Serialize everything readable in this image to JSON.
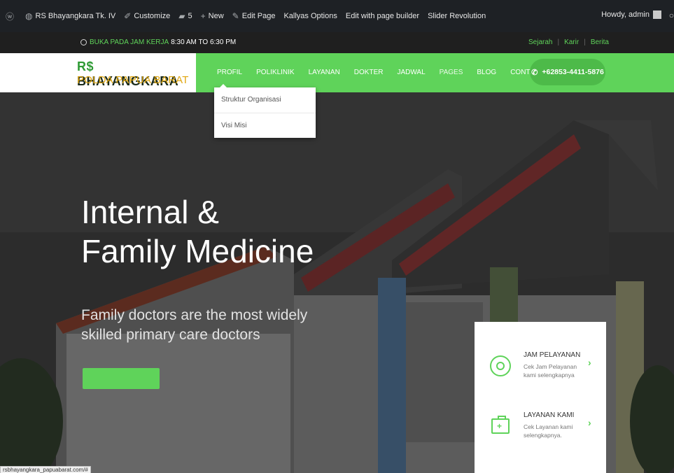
{
  "admin_bar": {
    "site_name": "RS Bhayangkara Tk. IV",
    "customize": "Customize",
    "comments_count": "5",
    "new_label": "New",
    "edit_page": "Edit Page",
    "kallyas_options": "Kallyas Options",
    "edit_builder": "Edit with page builder",
    "slider_revolution": "Slider Revolution",
    "howdy": "Howdy, admin"
  },
  "topbar": {
    "hours_label": "BUKA PADA JAM KERJA",
    "hours_value": "8:30 AM TO 6:30 PM",
    "links": [
      "Sejarah",
      "Karir",
      "Berita"
    ]
  },
  "logo": {
    "rs": "R$",
    "line1": "BHAYANGKARA",
    "line2": "POLDA PAPUA BARAT"
  },
  "nav": {
    "items": [
      "PROFIL",
      "POLIKLINIK",
      "LAYANAN",
      "DOKTER",
      "JADWAL",
      "PAGES",
      "BLOG",
      "CONTACT"
    ],
    "phone": "+62853-4411-5876"
  },
  "dropdown": {
    "items": [
      "Struktur Organisasi",
      "Visi Misi"
    ]
  },
  "hero": {
    "title_line1": "Internal &",
    "title_line2": "Family Medicine",
    "sub_line1": "Family doctors are the most widely",
    "sub_line2": "skilled primary care doctors"
  },
  "card": {
    "row1_title": "JAM PELAYANAN",
    "row1_desc": "Cek Jam Pelayanan kami selengkapnya",
    "row2_title": "LAYANAN KAMI",
    "row2_desc": "Cek Layanan kami selengkapnya."
  },
  "status_url": "rsbhayangkara_papuabarat.com/#",
  "colors": {
    "accent": "#5fd35a",
    "admin_bar": "#1e2125",
    "logo_gold": "#e0a60f"
  }
}
